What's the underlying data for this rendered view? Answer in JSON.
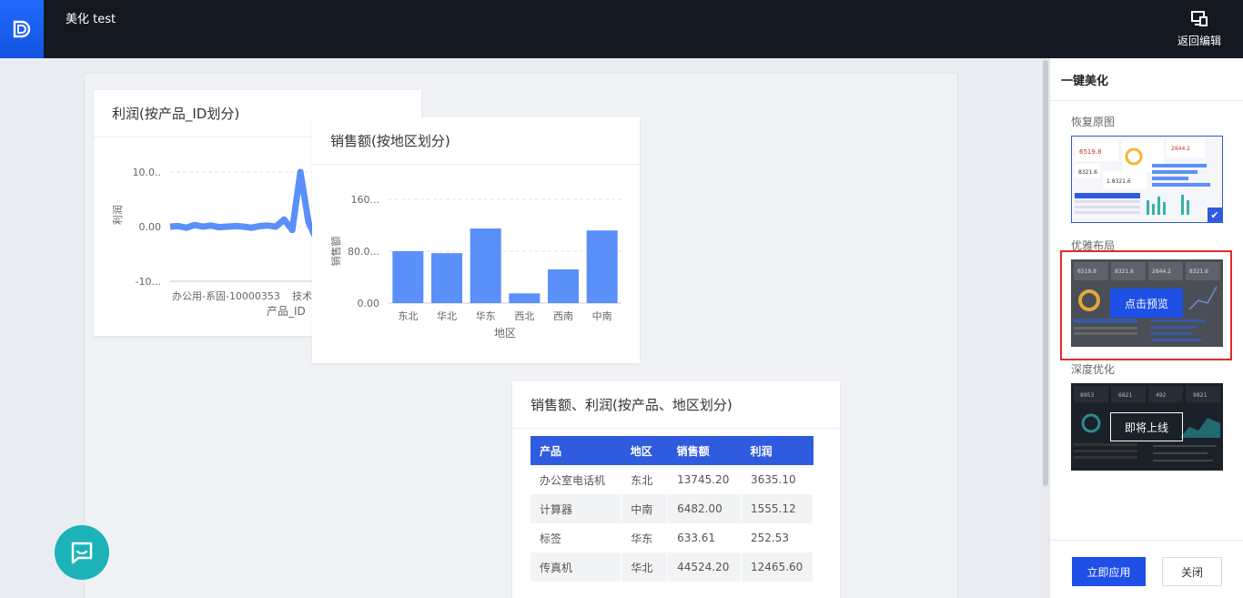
{
  "header": {
    "title": "美化 test",
    "back_edit_label": "返回编辑"
  },
  "profit_chart": {
    "title": "利润(按产品_ID划分)",
    "chart_data": {
      "type": "line",
      "title": "利润(按产品_ID划分)",
      "ylabel": "利润",
      "xlabel": "产品_ID",
      "y_ticks": [
        "10.0..",
        "0.00",
        "-10..."
      ],
      "x_ticks": [
        "办公用-系固-10000353",
        "技术"
      ],
      "ylim": [
        -10,
        10
      ],
      "series": [
        {
          "values": [
            0,
            0.1,
            -0.2,
            0.3,
            0,
            0.2,
            -0.1,
            0,
            0.1,
            0,
            -0.2,
            0.1,
            0.2,
            0,
            1.3,
            -0.6,
            10,
            0.8,
            -2.4
          ]
        }
      ]
    }
  },
  "sales_chart": {
    "title": "销售额(按地区划分)",
    "chart_data": {
      "type": "bar",
      "title": "销售额(按地区划分)",
      "xlabel": "地区",
      "ylabel": "销售额",
      "categories": [
        "东北",
        "华北",
        "华东",
        "西北",
        "西南",
        "中南"
      ],
      "values": [
        80,
        77,
        115,
        15,
        52,
        112
      ],
      "y_ticks": [
        "160...",
        "80.0...",
        "0.00"
      ],
      "ylim": [
        0,
        160
      ]
    }
  },
  "table_card": {
    "title": "销售额、利润(按产品、地区划分)",
    "columns": [
      "产品",
      "地区",
      "销售额",
      "利润"
    ],
    "rows": [
      [
        "办公室电话机",
        "东北",
        "13745.20",
        "3635.10"
      ],
      [
        "计算器",
        "中南",
        "6482.00",
        "1555.12"
      ],
      [
        "标签",
        "华东",
        "633.61",
        "252.53"
      ],
      [
        "传真机",
        "华北",
        "44524.20",
        "12465.60"
      ]
    ]
  },
  "side_panel": {
    "title": "一键美化",
    "options": [
      {
        "label": "恢复原图"
      },
      {
        "label": "优雅布局",
        "button": "点击预览"
      },
      {
        "label": "深度优化",
        "button": "即将上线"
      }
    ],
    "apply_label": "立即应用",
    "close_label": "关闭"
  },
  "thumb_numbers": {
    "t1": [
      "6519.8",
      "2844.2",
      "8321.6",
      "1.8321.6"
    ],
    "t2": [
      "6519.8",
      "8321.6",
      "2844.2",
      "8321.6"
    ],
    "t3": [
      "8953",
      "6821",
      "492",
      "9821"
    ]
  },
  "colors": {
    "accent": "#1e4fe6",
    "bar": "#5b8ff9",
    "header_bg": "#141821",
    "highlight": "#e02b2b"
  }
}
